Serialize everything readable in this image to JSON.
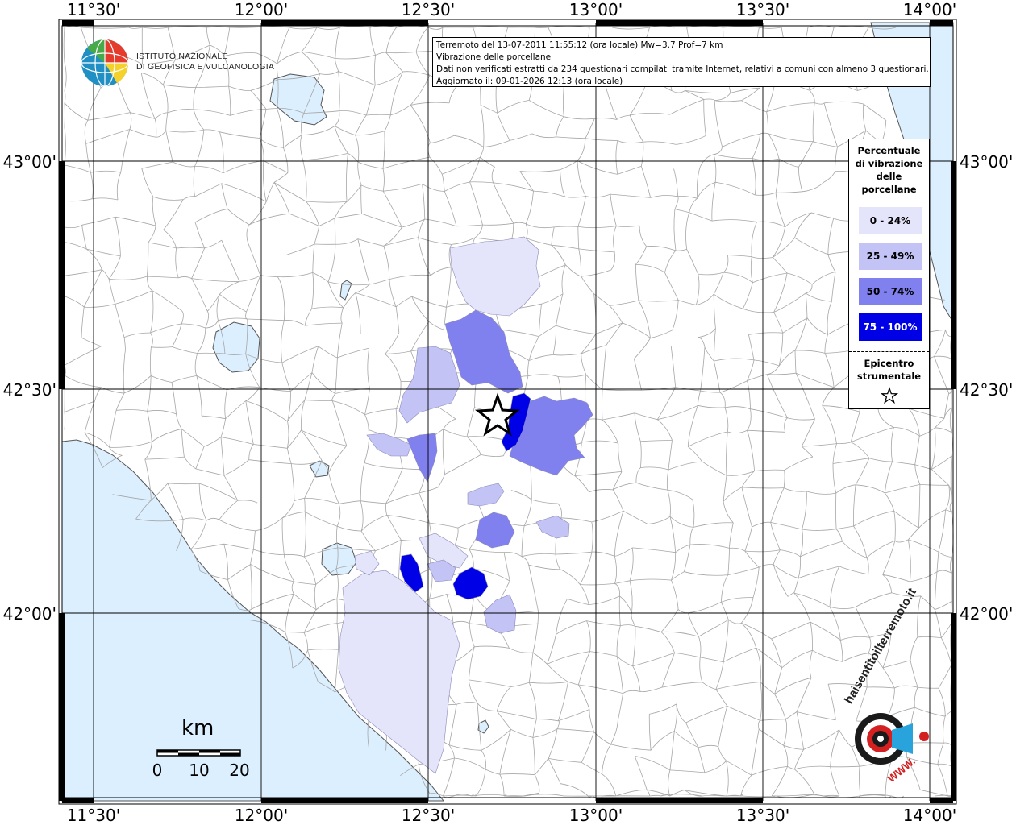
{
  "info": {
    "line1": "Terremoto del 13-07-2011 11:55:12 (ora locale) Mw=3.7 Prof=7 km",
    "line2": "Vibrazione delle porcellane",
    "line3": "Dati non verificati estratti da 234 questionari compilati tramite Internet, relativi a comuni con almeno 3 questionari.",
    "line4": "Aggiornato il: 09-01-2026 12:13 (ora locale)"
  },
  "logo": {
    "ingv_line1": "ISTITUTO NAZIONALE",
    "ingv_line2": "DI GEOFISICA E VULCANOLOGIA",
    "hsit_text": "haisentitoilterremoto.it",
    "hsit_url": "WWW."
  },
  "axes": {
    "lon_ticks": [
      "11°30'",
      "12°00'",
      "12°30'",
      "13°00'",
      "13°30'",
      "14°00'"
    ],
    "lat_ticks": [
      "43°00'",
      "42°30'",
      "42°00'"
    ]
  },
  "legend": {
    "title_lines": [
      "Percentuale",
      "di vibrazione",
      "delle",
      "porcellane"
    ],
    "classes": [
      {
        "label": "0 - 24%",
        "color": "#e4e4fa"
      },
      {
        "label": "25 - 49%",
        "color": "#c3c3f5"
      },
      {
        "label": "50 - 74%",
        "color": "#8080ee"
      },
      {
        "label": "75 - 100%",
        "color": "#0000e6"
      }
    ],
    "epicenter_lines": [
      "Epicentro",
      "strumentale"
    ]
  },
  "scale": {
    "unit": "km",
    "labels": [
      "0",
      "10",
      "20"
    ]
  },
  "colors": {
    "sea": "#dcefff",
    "border": "#9a9a9a",
    "grid": "#000000"
  }
}
